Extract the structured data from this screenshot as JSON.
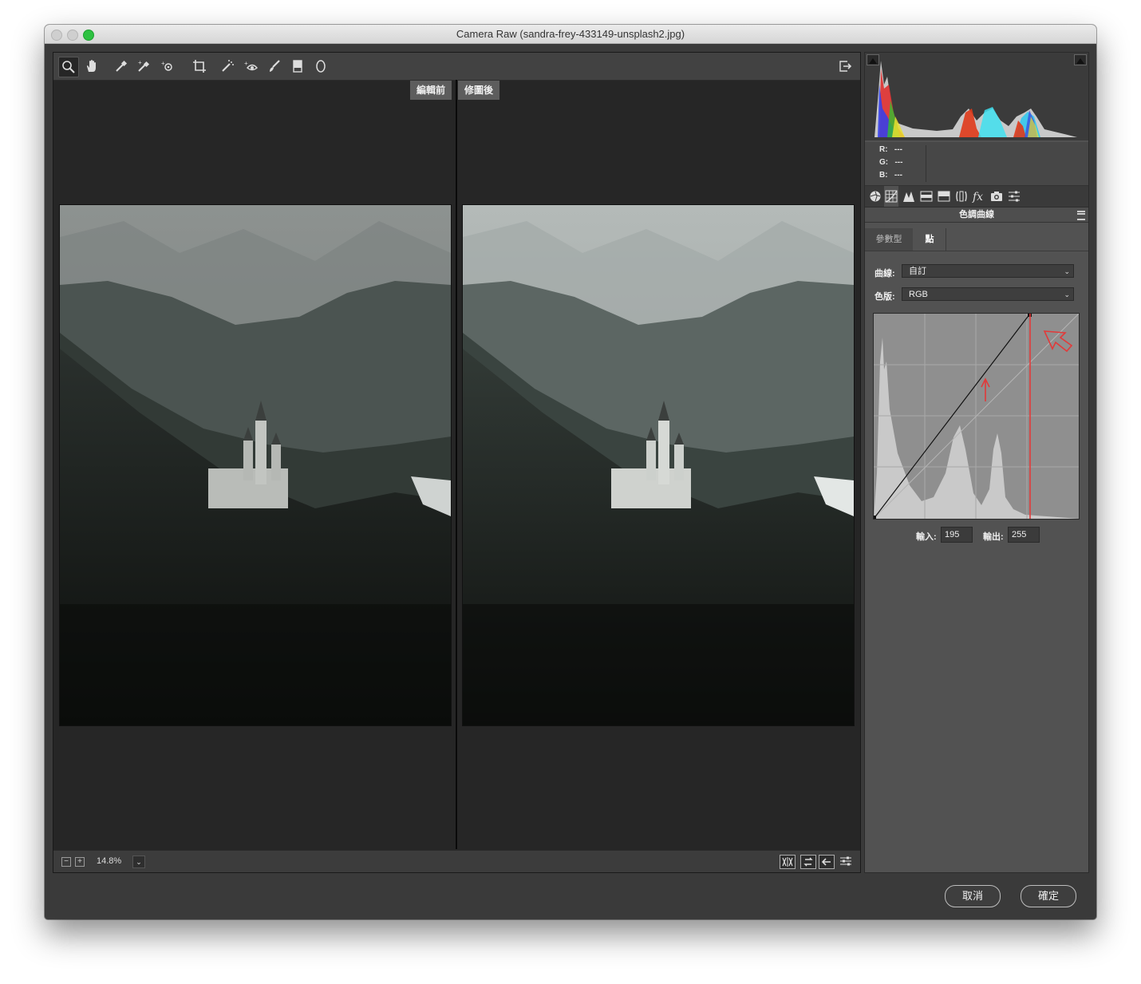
{
  "window": {
    "title": "Camera Raw (sandra-frey-433149-unsplash2.jpg)",
    "traffic_colors": [
      "#c9c9c9",
      "#c9c9c9",
      "#28c940"
    ]
  },
  "toolbar": {
    "tools": [
      "zoom-icon",
      "hand-icon",
      "white-balance-icon",
      "color-sampler-icon",
      "targeted-adjustment-icon",
      "crop-icon",
      "spot-removal-icon",
      "red-eye-icon",
      "adjustment-brush-icon",
      "graduated-filter-icon",
      "radial-filter-icon"
    ],
    "export_icon": "open-in-photoshop-icon"
  },
  "preview": {
    "before_label": "編輯前",
    "after_label": "修圖後"
  },
  "status": {
    "zoom": "14.8%",
    "zoom_out": "−",
    "zoom_in": "+",
    "view_icons": [
      "before-after-view-icon",
      "swap-settings-icon",
      "copy-settings-icon",
      "preferences-icon"
    ]
  },
  "histogram": {
    "r_label": "R:",
    "r_value": "---",
    "g_label": "G:",
    "g_value": "---",
    "b_label": "B:",
    "b_value": "---"
  },
  "panel": {
    "tab_icons": [
      "basic-icon",
      "tone-curve-icon",
      "detail-icon",
      "hsl-icon",
      "split-toning-icon",
      "lens-icon",
      "fx-icon",
      "camera-calibration-icon",
      "presets-icon"
    ],
    "title": "色調曲線",
    "subtab_parametric": "參數型",
    "subtab_point": "點",
    "curve_label": "曲線:",
    "curve_value": "自訂",
    "channel_label": "色版:",
    "channel_value": "RGB",
    "input_label": "輸入:",
    "input_value": "195",
    "output_label": "輸出:",
    "output_value": "255"
  },
  "buttons": {
    "cancel": "取消",
    "ok": "確定"
  },
  "colors": {
    "annotation_red": "#e23a3a",
    "panel_bg": "#525252",
    "preview_bg": "#262626"
  }
}
